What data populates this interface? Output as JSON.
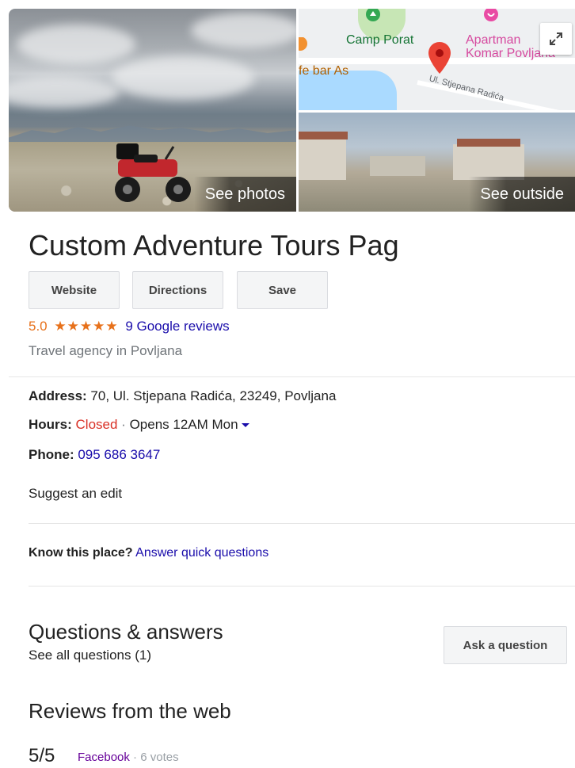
{
  "media": {
    "see_photos_label": "See photos",
    "see_outside_label": "See outside",
    "map_labels": {
      "camp": "Camp Porat",
      "bar": "fe bar As",
      "apartment_line1": "Apartman",
      "apartment_line2": "Komar Povljana",
      "street": "Ul. Stjepana Radića"
    }
  },
  "place": {
    "title": "Custom Adventure Tours Pag",
    "buttons": {
      "website": "Website",
      "directions": "Directions",
      "save": "Save"
    },
    "rating": "5.0",
    "stars": "★★★★★",
    "reviews_link": "9 Google reviews",
    "category": "Travel agency in Povljana"
  },
  "details": {
    "address_label": "Address:",
    "address_value": "70, Ul. Stjepana Radića, 23249, Povljana",
    "hours_label": "Hours:",
    "hours_status": "Closed",
    "hours_separator": "·",
    "hours_next": "Opens 12AM Mon",
    "phone_label": "Phone:",
    "phone_value": "095 686 3647",
    "suggest_edit": "Suggest an edit"
  },
  "know_place": {
    "prompt": "Know this place?",
    "link": "Answer quick questions"
  },
  "qa": {
    "heading": "Questions & answers",
    "see_all": "See all questions (1)",
    "ask_button": "Ask a question"
  },
  "web_reviews": {
    "heading": "Reviews from the web",
    "score": "5/5",
    "source": "Facebook",
    "separator": "·",
    "votes": "6 votes"
  },
  "colors": {
    "link": "#1a0dab",
    "rating": "#e7711b",
    "closed": "#d93025",
    "map_pin": "#ea4335"
  }
}
